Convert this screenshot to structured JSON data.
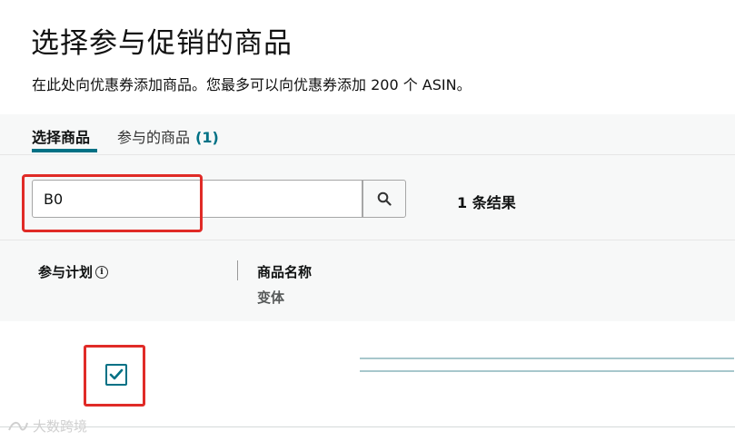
{
  "page": {
    "title": "选择参与促销的商品",
    "subtitle": "在此处向优惠券添加商品。您最多可以向优惠券添加 200 个 ASIN。"
  },
  "tabs": [
    {
      "label": "选择商品",
      "active": true
    },
    {
      "label": "参与的商品",
      "count": "(1)",
      "active": false
    }
  ],
  "search": {
    "value": "B0",
    "result_count": "1 条结果"
  },
  "table": {
    "columns": {
      "participate": "参与计划",
      "name": "商品名称",
      "variant": "变体"
    },
    "rows": [
      {
        "checked": true
      }
    ]
  },
  "watermark": "大数跨境",
  "colors": {
    "accent": "#007185",
    "highlight": "#e02b27"
  },
  "icons": {
    "search": "magnifier-icon",
    "info": "info-icon",
    "check": "checkmark-icon"
  }
}
